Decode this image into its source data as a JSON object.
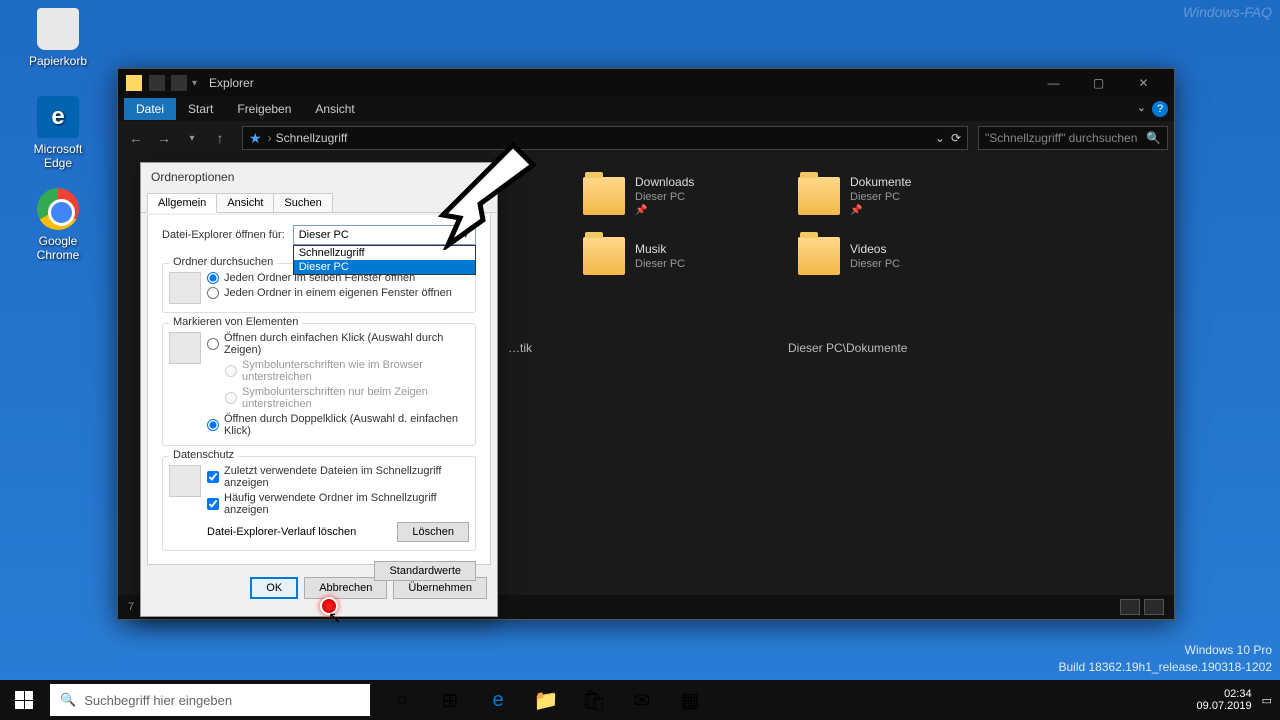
{
  "desktop": {
    "recycle": "Papierkorb",
    "edge": "Microsoft Edge",
    "chrome": "Google Chrome"
  },
  "explorer": {
    "title": "Explorer",
    "tabs": {
      "file": "Datei",
      "start": "Start",
      "share": "Freigeben",
      "view": "Ansicht"
    },
    "breadcrumb": "Schnellzugriff",
    "search_placeholder": "\"Schnellzugriff\" durchsuchen",
    "folders": {
      "downloads": {
        "name": "Downloads",
        "sub": "Dieser PC"
      },
      "documents": {
        "name": "Dokumente",
        "sub": "Dieser PC"
      },
      "music": {
        "name": "Musik",
        "sub": "Dieser PC"
      },
      "videos": {
        "name": "Videos",
        "sub": "Dieser PC"
      }
    },
    "doc_path": "Dieser PC\\Dokumente",
    "status": "7"
  },
  "dialog": {
    "title": "Ordneroptionen",
    "tabs": {
      "general": "Allgemein",
      "view": "Ansicht",
      "search": "Suchen"
    },
    "open_for": "Datei-Explorer öffnen für:",
    "combo_value": "Dieser PC",
    "dropdown": {
      "quick": "Schnellzugriff",
      "pc": "Dieser PC"
    },
    "browse_group": "Ordner durchsuchen",
    "browse_same": "Jeden Ordner im selben Fenster öffnen",
    "browse_own": "Jeden Ordner in einem eigenen Fenster öffnen",
    "click_group": "Markieren von Elementen",
    "single_click": "Öffnen durch einfachen Klick (Auswahl durch Zeigen)",
    "underline_browser": "Symbolunterschriften wie im Browser unterstreichen",
    "underline_point": "Symbolunterschriften nur beim Zeigen unterstreichen",
    "double_click": "Öffnen durch Doppelklick (Auswahl d. einfachen Klick)",
    "privacy_group": "Datenschutz",
    "recent_files": "Zuletzt verwendete Dateien im Schnellzugriff anzeigen",
    "frequent_folders": "Häufig verwendete Ordner im Schnellzugriff anzeigen",
    "clear_label": "Datei-Explorer-Verlauf löschen",
    "clear_btn": "Löschen",
    "defaults_btn": "Standardwerte",
    "ok": "OK",
    "cancel": "Abbrechen",
    "apply": "Übernehmen"
  },
  "taskbar": {
    "search_placeholder": "Suchbegriff hier eingeben"
  },
  "watermark": {
    "line1": "Windows 10 Pro",
    "line2": "Build 18362.19h1_release.190318-1202",
    "clock": "02:34",
    "date": "09.07.2019"
  },
  "faq": "Windows-FAQ"
}
